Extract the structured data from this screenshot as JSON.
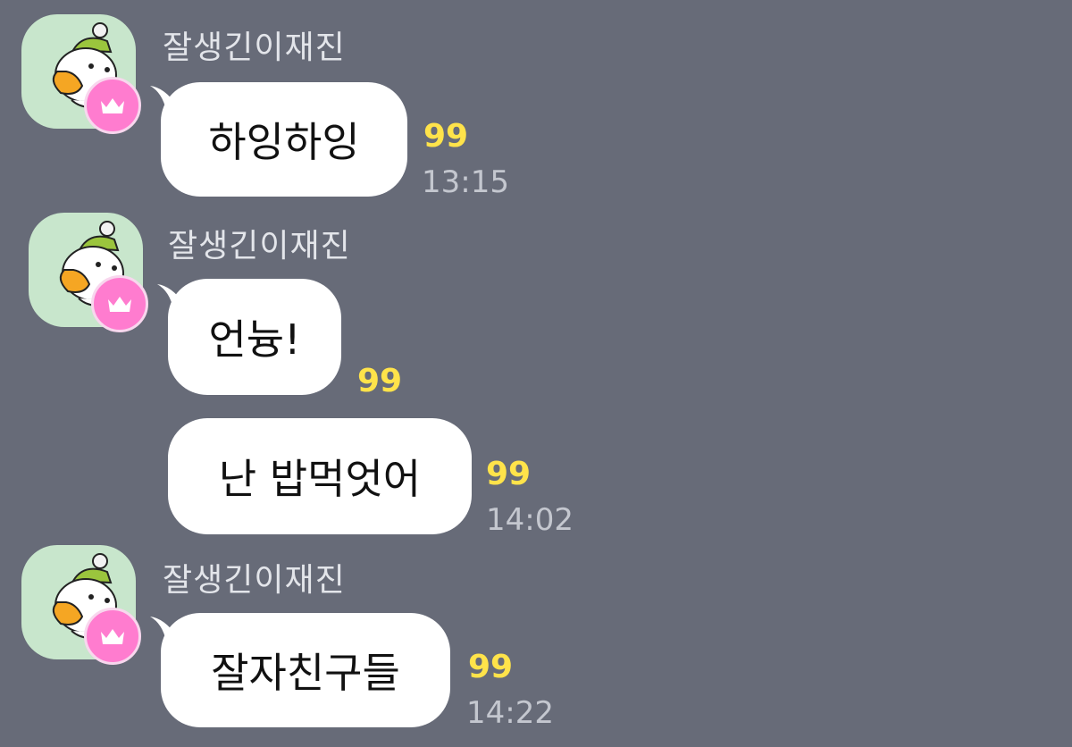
{
  "messages": [
    {
      "sender": "잘생긴이재진",
      "text": "하잉하잉",
      "unread": "99",
      "time": "13:15"
    },
    {
      "sender": "잘생긴이재진",
      "text": "언늉!",
      "unread": "99",
      "time": ""
    },
    {
      "sender": "",
      "text": "난 밥먹엇어",
      "unread": "99",
      "time": "14:02"
    },
    {
      "sender": "잘생긴이재진",
      "text": "잘자친구들",
      "unread": "99",
      "time": "14:22"
    }
  ],
  "avatar": {
    "icon": "duck-character-avatar",
    "badge_icon": "crown-icon"
  },
  "colors": {
    "background": "#676b78",
    "bubble": "#ffffff",
    "unread": "#ffe34a",
    "time": "#c4c7cf",
    "name": "#e3e5ea",
    "badge": "#ff7ccf",
    "avatar_bg": "#c8e6cc"
  }
}
